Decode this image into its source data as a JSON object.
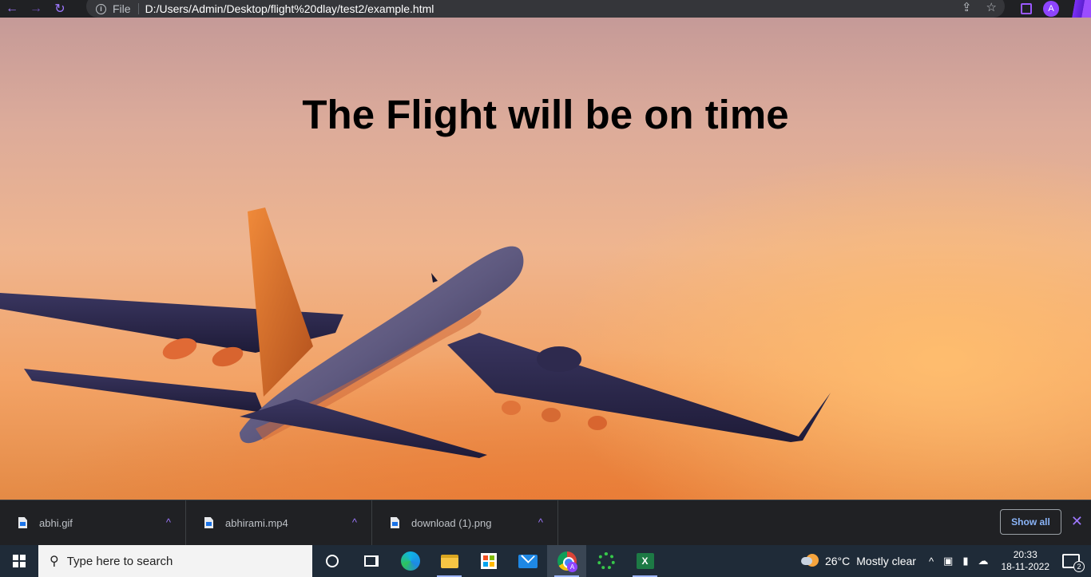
{
  "browser": {
    "back_icon": "←",
    "forward_icon": "→",
    "reload_icon": "↻",
    "scheme_label": "File",
    "url": "D:/Users/Admin/Desktop/flight%20dlay/test2/example.html",
    "share_icon": "⇪",
    "star_icon": "☆",
    "profile_initial": "A"
  },
  "page": {
    "heading": "The Flight will be on time"
  },
  "downloads": {
    "items": [
      {
        "name": "abhi.gif"
      },
      {
        "name": "abhirami.mp4"
      },
      {
        "name": "download (1).png"
      }
    ],
    "caret": "^",
    "show_all_label": "Show all",
    "close_icon": "✕"
  },
  "taskbar": {
    "search_placeholder": "Type here to search",
    "chrome_badge": "A",
    "excel_letter": "X",
    "weather": {
      "temperature": "26°C",
      "condition": "Mostly clear"
    },
    "tray_chevron": "^",
    "clock": {
      "time": "20:33",
      "date": "18-11-2022"
    },
    "notification_count": "2"
  }
}
